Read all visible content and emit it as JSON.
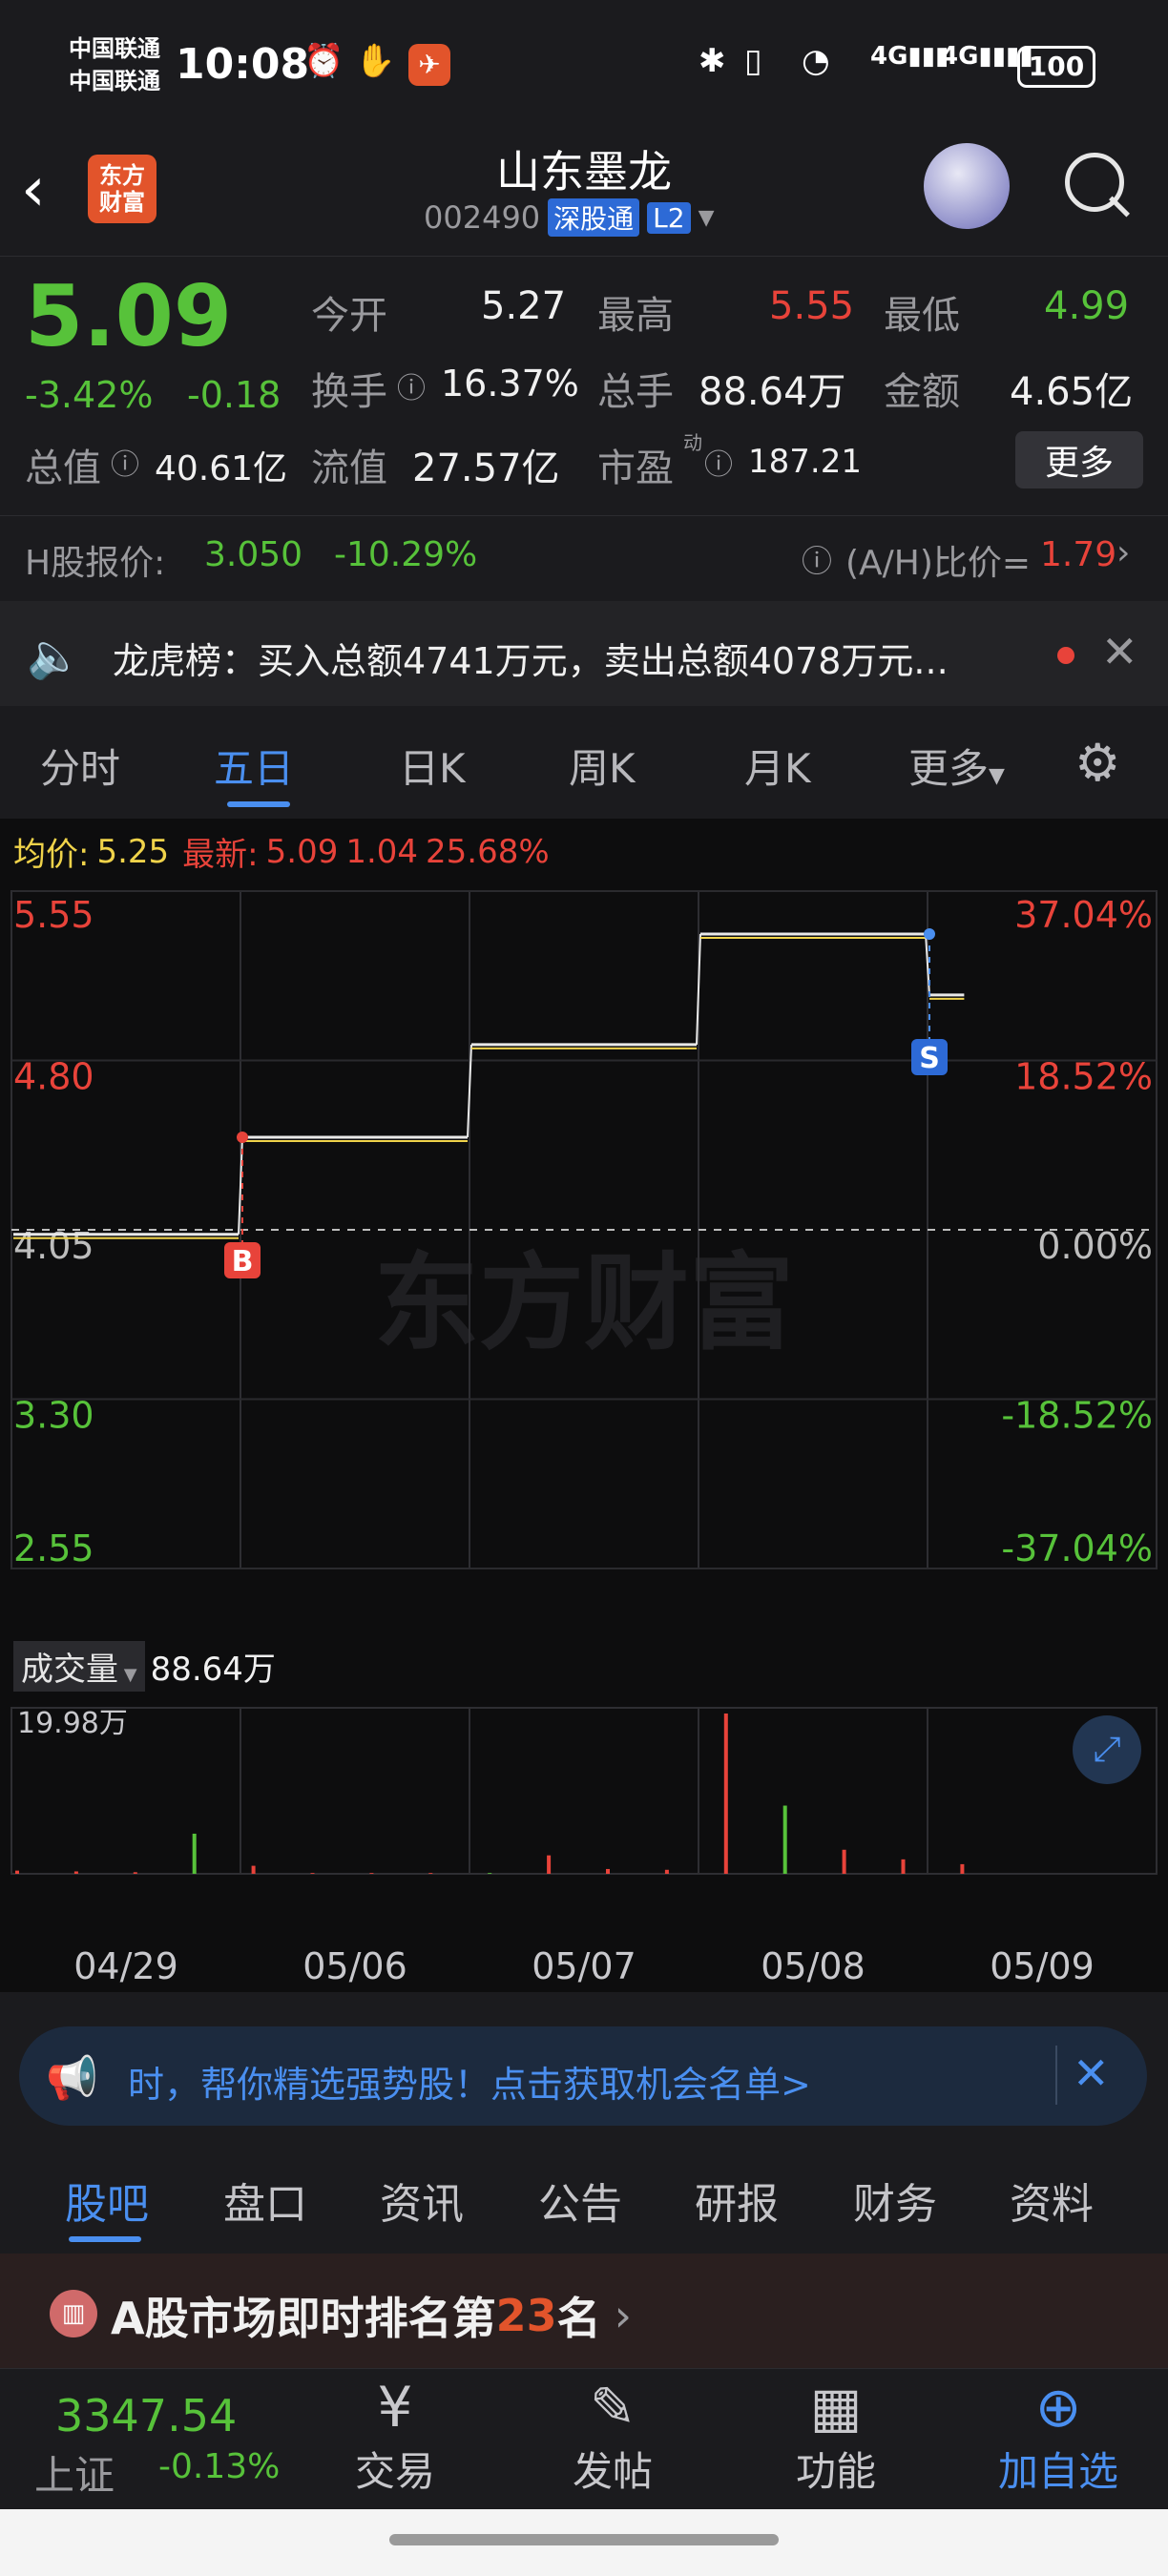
{
  "status_bar": {
    "carrier1": "中国联通",
    "carrier2": "中国联通",
    "time": "10:08",
    "battery": "100"
  },
  "header": {
    "logo_line1": "东方",
    "logo_line2": "财富",
    "title": "山东墨龙",
    "code": "002490",
    "connect_badge": "深股通",
    "level_badge": "L2"
  },
  "quote": {
    "price": "5.09",
    "change_pct": "-3.42%",
    "change": "-0.18",
    "open_label": "今开",
    "open": "5.27",
    "high_label": "最高",
    "high": "5.55",
    "low_label": "最低",
    "low": "4.99",
    "turnover_label": "换手",
    "turnover": "16.37%",
    "volume_label": "总手",
    "volume": "88.64万",
    "amount_label": "金额",
    "amount": "4.65亿",
    "mktcap_label": "总值",
    "mktcap": "40.61亿",
    "float_label": "流值",
    "float": "27.57亿",
    "pe_label": "市盈",
    "pe_sup": "动",
    "pe": "187.21",
    "more": "更多"
  },
  "hshare": {
    "label": "H股报价:",
    "price": "3.050",
    "pct": "-10.29%",
    "ratio_label": "(A/H)比价=",
    "ratio": "1.79"
  },
  "notice": {
    "text": "龙虎榜：买入总额4741万元，卖出总额4078万元..."
  },
  "ktabs": [
    "分时",
    "五日",
    "日K",
    "周K",
    "月K",
    "更多"
  ],
  "chart_header": {
    "avg_label": "均价:",
    "avg": "5.25",
    "latest_label": "最新:",
    "latest": "5.09",
    "chg": "1.04",
    "pct": "25.68%"
  },
  "chart_data": {
    "type": "line",
    "title": "",
    "x": [
      "04/29",
      "05/06",
      "05/07",
      "05/08",
      "05/09"
    ],
    "y_ticks_left": [
      "5.55",
      "4.80",
      "4.05",
      "3.30",
      "2.55"
    ],
    "y_ticks_right": [
      "37.04%",
      "18.52%",
      "0.00%",
      "-18.52%",
      "-37.04%"
    ],
    "ylim": [
      2.55,
      5.55
    ],
    "base": 4.05,
    "series": [
      {
        "values": [
          4.03,
          4.46,
          4.87,
          5.36,
          5.09
        ]
      }
    ],
    "markers": [
      {
        "label": "B",
        "day": "05/06",
        "value": 4.46
      },
      {
        "label": "S",
        "day": "05/09",
        "value": 5.36
      }
    ],
    "watermark": "东方财富",
    "volume": {
      "label": "成交量",
      "total": "88.64万",
      "max_tick": "19.98万",
      "max_value": 19.98,
      "bars": [
        0.4,
        0.3,
        0.2,
        5.0,
        1.0,
        0.1,
        0.1,
        0.1,
        0.1,
        2.3,
        0.6,
        0.5,
        19.98,
        8.5,
        3.0,
        1.8,
        1.2
      ]
    }
  },
  "banner": {
    "text": "时，帮你精选强势股！点击获取机会名单>"
  },
  "btabs": [
    "股吧",
    "盘口",
    "资讯",
    "公告",
    "研报",
    "财务",
    "资料"
  ],
  "rank": {
    "prefix": "A股市场即时排名第",
    "num": "23",
    "suffix": "名"
  },
  "bottombar": {
    "index_value": "3347.54",
    "index_name": "上证",
    "index_pct": "-0.13%",
    "trade": "交易",
    "post": "发帖",
    "func": "功能",
    "watch": "加自选"
  }
}
